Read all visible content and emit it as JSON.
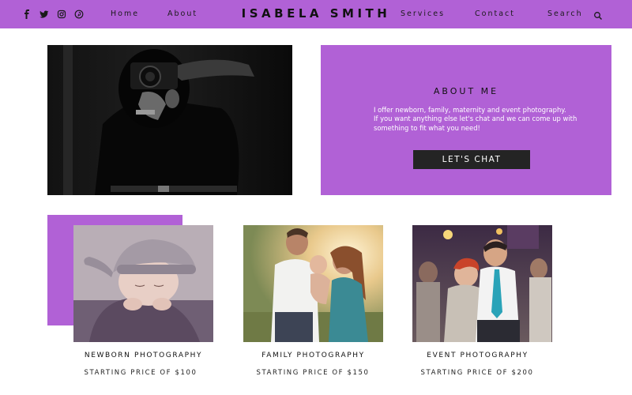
{
  "header": {
    "brand": "ISABELA SMITH",
    "nav": {
      "home": "Home",
      "about": "About",
      "services": "Services",
      "contact": "Contact",
      "search": "Search"
    },
    "social_icons": [
      "facebook-icon",
      "twitter-icon",
      "instagram-icon",
      "pinterest-icon"
    ]
  },
  "about": {
    "title": "ABOUT ME",
    "line1": "I offer newborn, family, maternity and event photography.",
    "line2": "If you want anything else let's chat and we can come up with something to fit what you need!",
    "button": "LET'S CHAT"
  },
  "services": [
    {
      "title": "NEWBORN PHOTOGRAPHY",
      "price": "STARTING PRICE OF $100"
    },
    {
      "title": "FAMILY PHOTOGRAPHY",
      "price": "STARTING PRICE OF $150"
    },
    {
      "title": "EVENT PHOTOGRAPHY",
      "price": "STARTING PRICE OF $200"
    }
  ],
  "colors": {
    "accent": "#b161d6",
    "button": "#242424"
  }
}
